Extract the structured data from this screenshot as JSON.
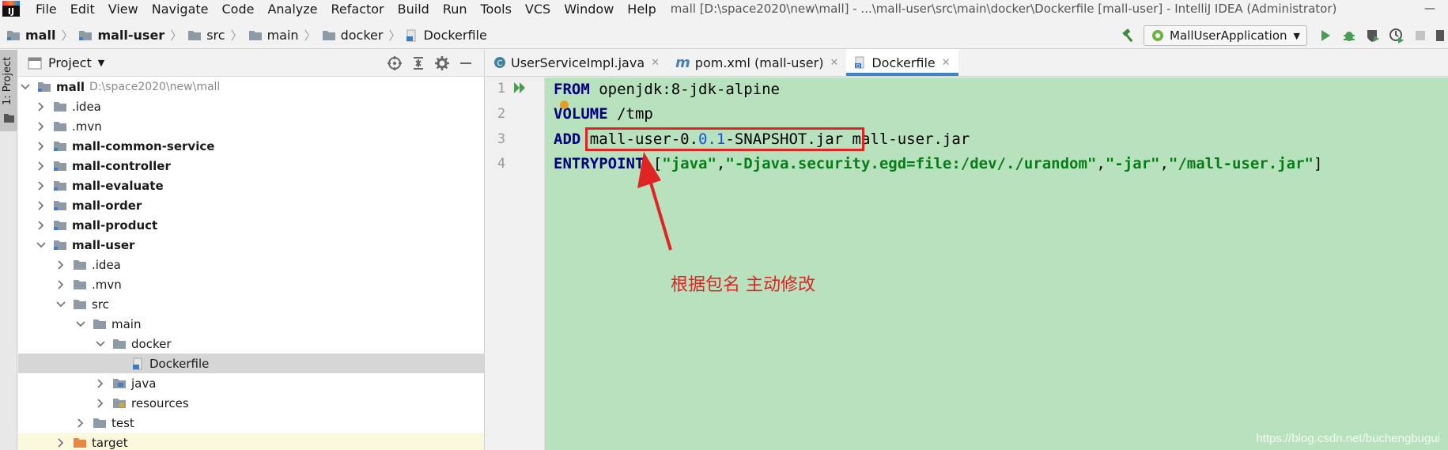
{
  "app": {
    "logo_text": "IJ"
  },
  "menu": {
    "items": [
      "File",
      "Edit",
      "View",
      "Navigate",
      "Code",
      "Analyze",
      "Refactor",
      "Build",
      "Run",
      "Tools",
      "VCS",
      "Window",
      "Help"
    ]
  },
  "window": {
    "title": "mall [D:\\space2020\\new\\mall] - ...\\mall-user\\src\\main\\docker\\Dockerfile [mall-user] - IntelliJ IDEA (Administrator)",
    "minimize": "—",
    "maximize": "☐",
    "close": "✕"
  },
  "breadcrumb": [
    "mall",
    "mall-user",
    "src",
    "main",
    "docker",
    "Dockerfile"
  ],
  "toolbar": {
    "run_config": "MallUserApplication"
  },
  "stripe": {
    "project_label": "1: Project"
  },
  "project_panel": {
    "title": "Project",
    "tree": [
      {
        "label": "mall",
        "path": "D:\\space2020\\new\\mall"
      },
      {
        "label": ".idea"
      },
      {
        "label": ".mvn"
      },
      {
        "label": "mall-common-service"
      },
      {
        "label": "mall-controller"
      },
      {
        "label": "mall-evaluate"
      },
      {
        "label": "mall-order"
      },
      {
        "label": "mall-product"
      },
      {
        "label": "mall-user"
      },
      {
        "label": ".idea"
      },
      {
        "label": ".mvn"
      },
      {
        "label": "src"
      },
      {
        "label": "main"
      },
      {
        "label": "docker"
      },
      {
        "label": "Dockerfile"
      },
      {
        "label": "java"
      },
      {
        "label": "resources"
      },
      {
        "label": "test"
      },
      {
        "label": "target"
      }
    ]
  },
  "editor": {
    "tabs": [
      {
        "label": "UserServiceImpl.java",
        "icon_letter": "C"
      },
      {
        "label": "pom.xml (mall-user)",
        "icon_letter": "m"
      },
      {
        "label": "Dockerfile",
        "icon_letter": "D"
      }
    ],
    "line_numbers": [
      "1",
      "2",
      "3",
      "4"
    ],
    "code": {
      "l1_kw": "FROM",
      "l1_rest": " openjdk:8-jdk-alpine",
      "l2_kw": "VOLUME",
      "l2_rest": " /tmp",
      "l3_kw": "ADD",
      "l3_a": " mall-user-0.",
      "l3_b": "0.1",
      "l3_c": "-SNAPSHOT.jar mall-user.jar",
      "l4_kw": "ENTRYPOINT",
      "l4_a": " [",
      "l4_s1": "\"java\"",
      "l4_c1": ",",
      "l4_s2": "\"-Djava.security.egd=file:/dev/./urandom\"",
      "l4_c2": ",",
      "l4_s3": "\"-jar\"",
      "l4_c3": ",",
      "l4_s4": "\"/mall-user.jar\"",
      "l4_end": "]"
    }
  },
  "annotation": {
    "text": "根据包名 主动修改"
  },
  "watermark": "https://blog.csdn.net/buchengbugui",
  "colors": {
    "code_bg": "#b8e2bd",
    "annotation": "#e02424",
    "keyword": "#000080",
    "string": "#067d17"
  }
}
